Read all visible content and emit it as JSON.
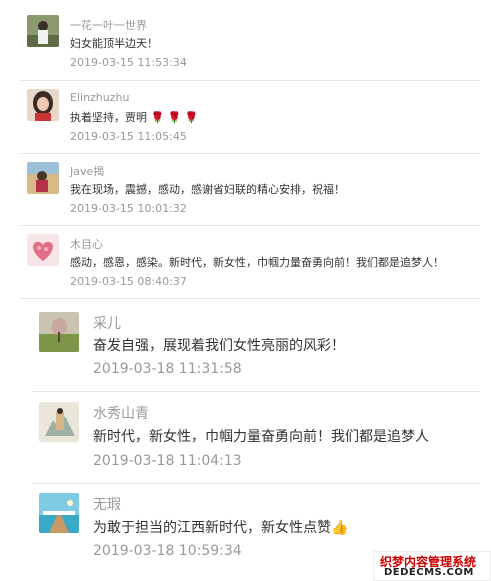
{
  "comments": [
    {
      "name": "一花一叶一世界",
      "text": "妇女能顶半边天！",
      "time": "2019-03-15 11:53:34"
    },
    {
      "name": "Elinzhuzhu",
      "text": "执着坚持，贾明",
      "time": "2019-03-15 11:05:45",
      "emoji": "🌹 🌹 🌹"
    },
    {
      "name": "Jave揭",
      "text": "我在现场，震撼，感动，感谢省妇联的精心安排，祝福！",
      "time": "2019-03-15 10:01:32"
    },
    {
      "name": "木目心",
      "text": "感动，感恩，感染。新时代，新女性，巾帼力量奋勇向前！我们都是追梦人！",
      "time": "2019-03-15 08:40:37"
    },
    {
      "name": "采儿",
      "text": "奋发自强，展现着我们女性亮丽的风彩！",
      "time": "2019-03-18 11:31:58"
    },
    {
      "name": "水秀山青",
      "text": "新时代，新女性，巾帼力量奋勇向前！我们都是追梦人",
      "time": "2019-03-18 11:04:13"
    },
    {
      "name": "无瑕",
      "text": "为敢于担当的江西新时代，新女性点赞",
      "time": "2019-03-18 10:59:34",
      "emoji": "👍"
    }
  ],
  "watermark": {
    "top": "织梦内容管理系统",
    "bottom": "DEDECMS.COM"
  }
}
